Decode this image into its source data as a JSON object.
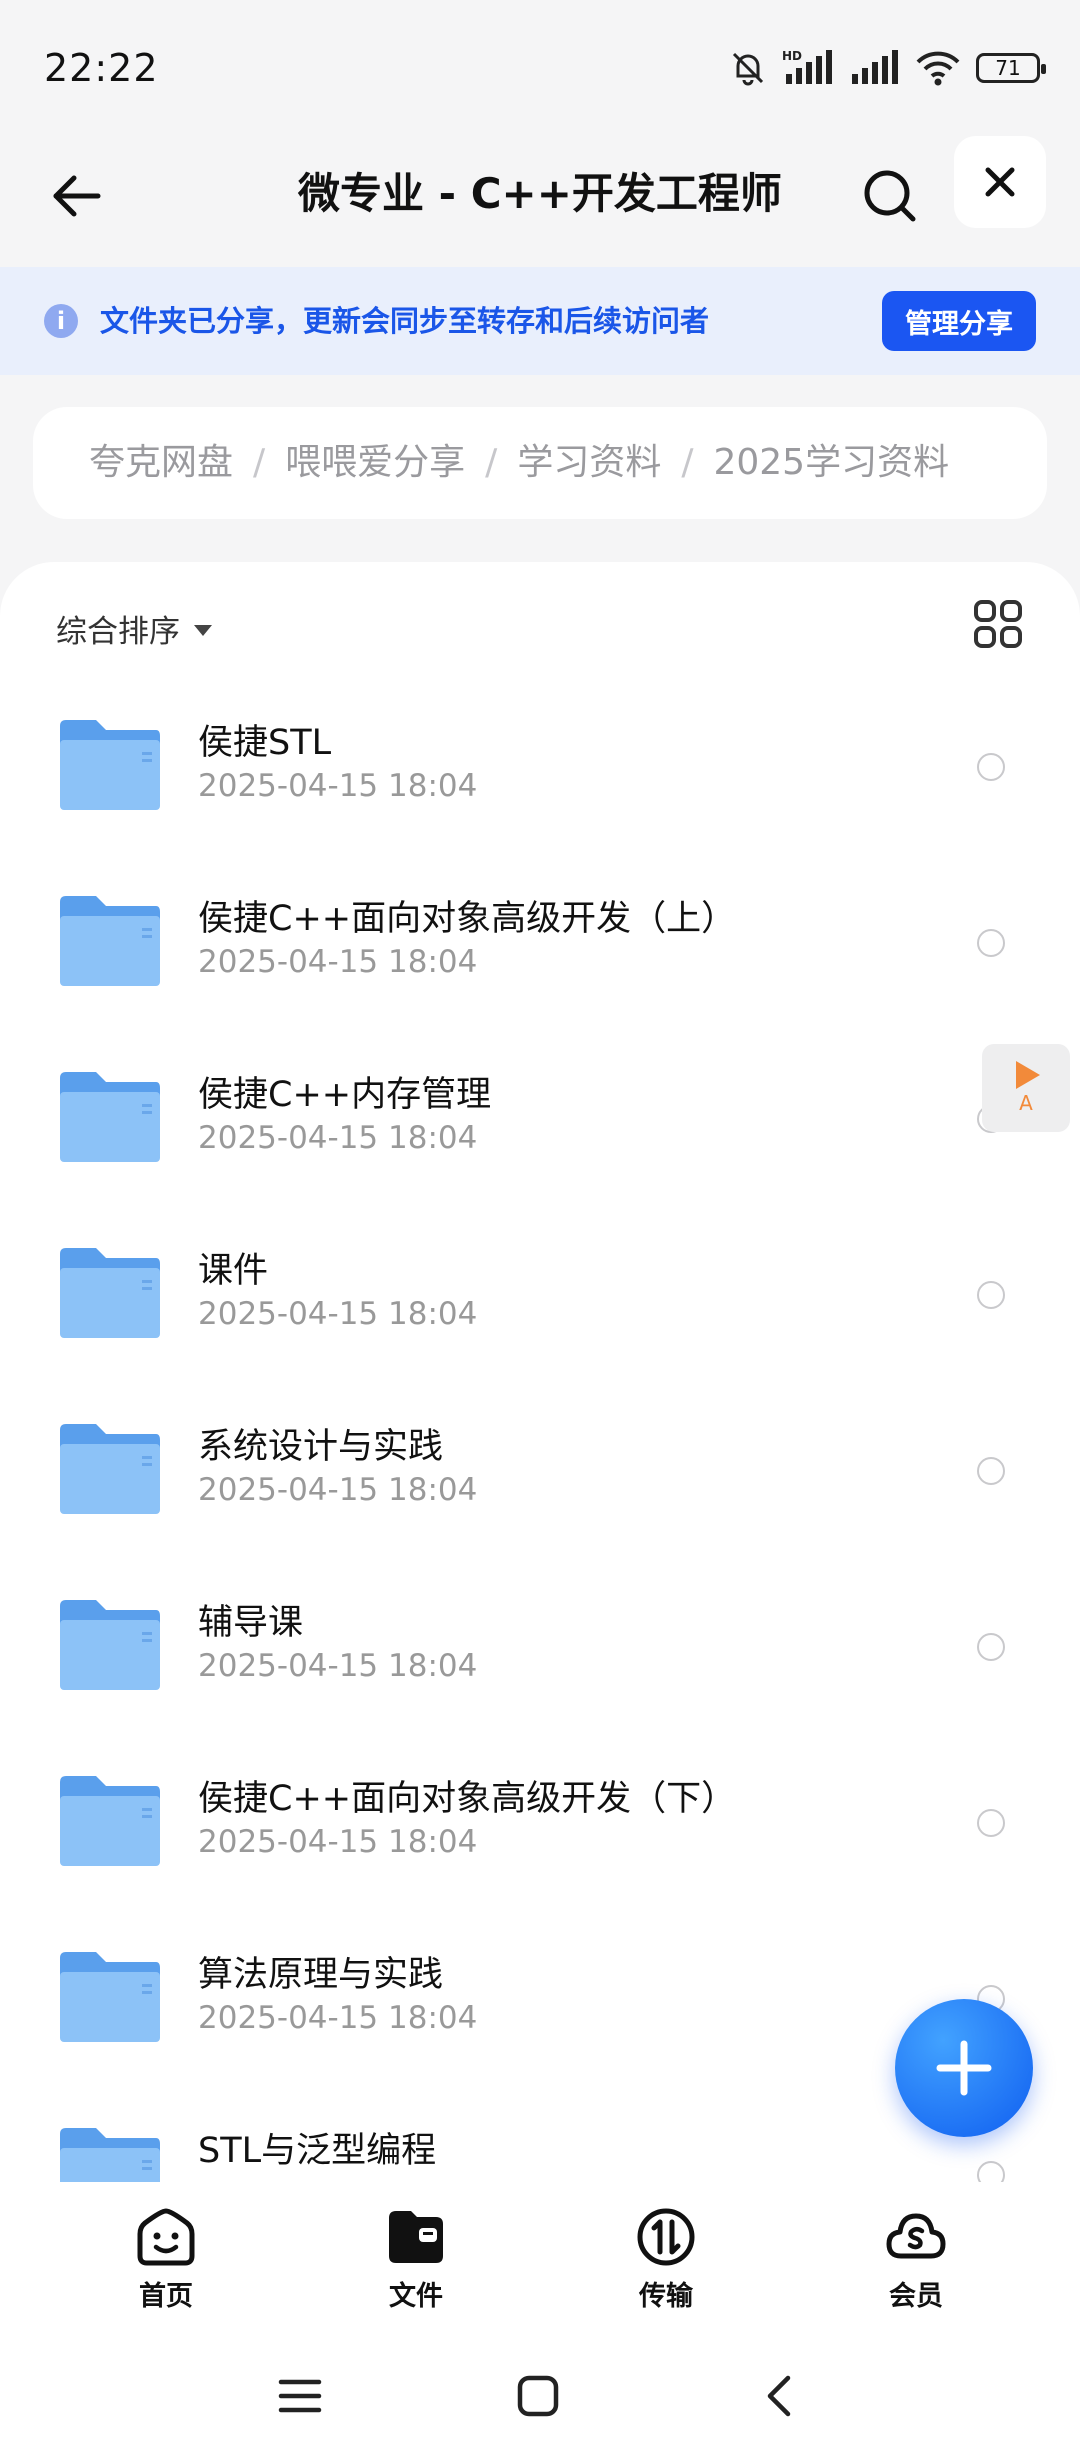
{
  "status_bar": {
    "time": "22:22",
    "battery": "71",
    "network_label": "HD"
  },
  "nav": {
    "title": "微专业 - C++开发工程师",
    "icons": {
      "back": "arrow-left-icon",
      "search": "search-icon",
      "close": "close-icon"
    }
  },
  "share_banner": {
    "text": "文件夹已分享，更新会同步至转存和后续访问者",
    "button": "管理分享",
    "accent": "#1b56f2"
  },
  "breadcrumb": [
    "夸克网盘",
    "喂喂爱分享",
    "学习资料",
    "2025学习资料"
  ],
  "toolbar": {
    "sort_label": "综合排序"
  },
  "files": [
    {
      "name": "侯捷STL",
      "date": "2025-04-15 18:04"
    },
    {
      "name": "侯捷C++面向对象高级开发（上）",
      "date": "2025-04-15 18:04"
    },
    {
      "name": "侯捷C++内存管理",
      "date": "2025-04-15 18:04"
    },
    {
      "name": "课件",
      "date": "2025-04-15 18:04"
    },
    {
      "name": "系统设计与实践",
      "date": "2025-04-15 18:04"
    },
    {
      "name": "辅导课",
      "date": "2025-04-15 18:04"
    },
    {
      "name": "侯捷C++面向对象高级开发（下）",
      "date": "2025-04-15 18:04"
    },
    {
      "name": "算法原理与实践",
      "date": "2025-04-15 18:04"
    },
    {
      "name": "STL与泛型编程",
      "date": ""
    }
  ],
  "floating_player": {
    "label": "A"
  },
  "tabs": [
    {
      "label": "首页",
      "icon": "home-smile-icon"
    },
    {
      "label": "文件",
      "icon": "folder-icon"
    },
    {
      "label": "传输",
      "icon": "transfer-icon"
    },
    {
      "label": "会员",
      "icon": "membership-cloud-icon"
    }
  ],
  "colors": {
    "folder": "#7ab6f5",
    "accent": "#1b56f2",
    "banner_bg": "#e9effc"
  }
}
